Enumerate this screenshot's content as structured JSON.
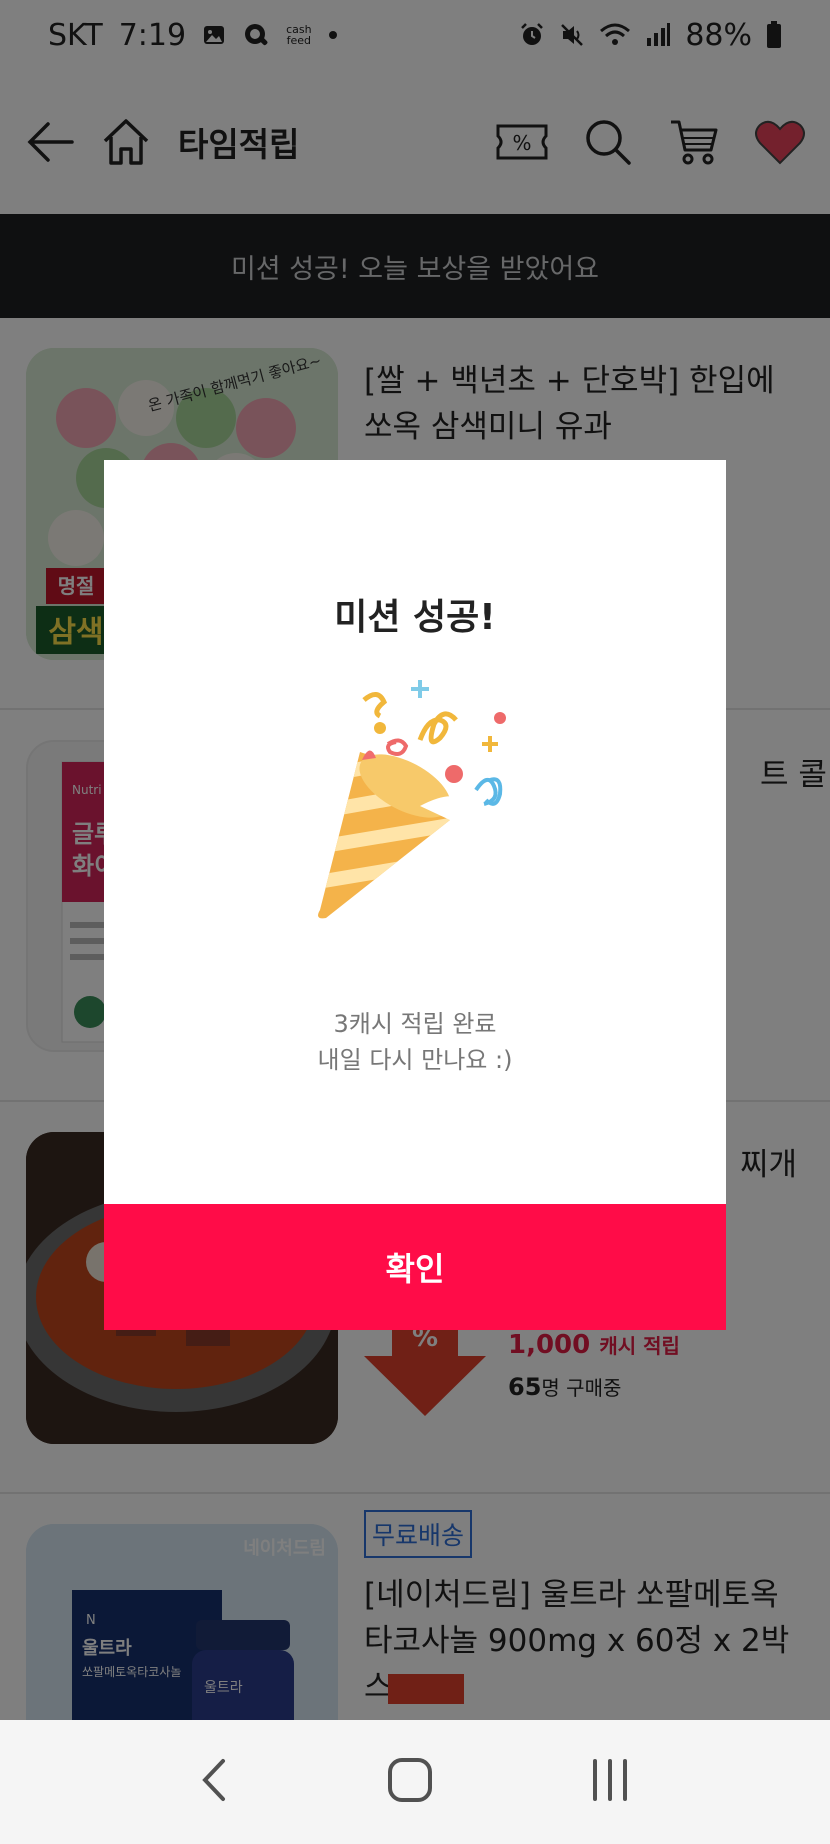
{
  "status_bar": {
    "carrier": "SKT",
    "time": "7:19",
    "cashfeed_label": "cash\nfeed",
    "battery": "88%"
  },
  "header": {
    "title": "타임적립",
    "coupon_icon_glyph": "%"
  },
  "banner": {
    "text": "미션 성공! 오늘 보상을 받았어요"
  },
  "products": [
    {
      "title": "[쌀 + 백년초 + 단호박] 한입에 쏘옥 삼색미니 유과",
      "thumb_text": "온 가족이 함께먹기 좋아요~",
      "thumb_tag_1": "명절",
      "thumb_tag_2": "삼색"
    },
    {
      "title_tail": "트 콜",
      "thumb_text_1": "글루",
      "thumb_text_2": "화이",
      "thumb_brand": "Nutri"
    },
    {
      "title_tail": "찌개",
      "discount_glyph": "%",
      "cash_amount": "1,000",
      "cash_suffix": "캐시 적립",
      "buyers_count": "65",
      "buyers_suffix": "명 구매중"
    },
    {
      "badge": "무료배송",
      "title": "[네이처드림] 울트라 쏘팔메토옥타코사놀 900mg x 60정 x 2박스",
      "thumb_brand": "네이처드림",
      "thumb_box_text_1": "울트라",
      "thumb_box_text_2": "쏘팔메토옥타코사놀",
      "thumb_bottle_text": "울트라"
    }
  ],
  "modal": {
    "title": "미션 성공!",
    "message_line1": "3캐시 적립 완료",
    "message_line2": "내일 다시 만나요 :)",
    "confirm_label": "확인"
  },
  "colors": {
    "accent": "#ff0c48",
    "banner_bg": "#1f2023",
    "wishlist_heart": "#e8435b",
    "badge_blue": "#2f6fd6"
  }
}
